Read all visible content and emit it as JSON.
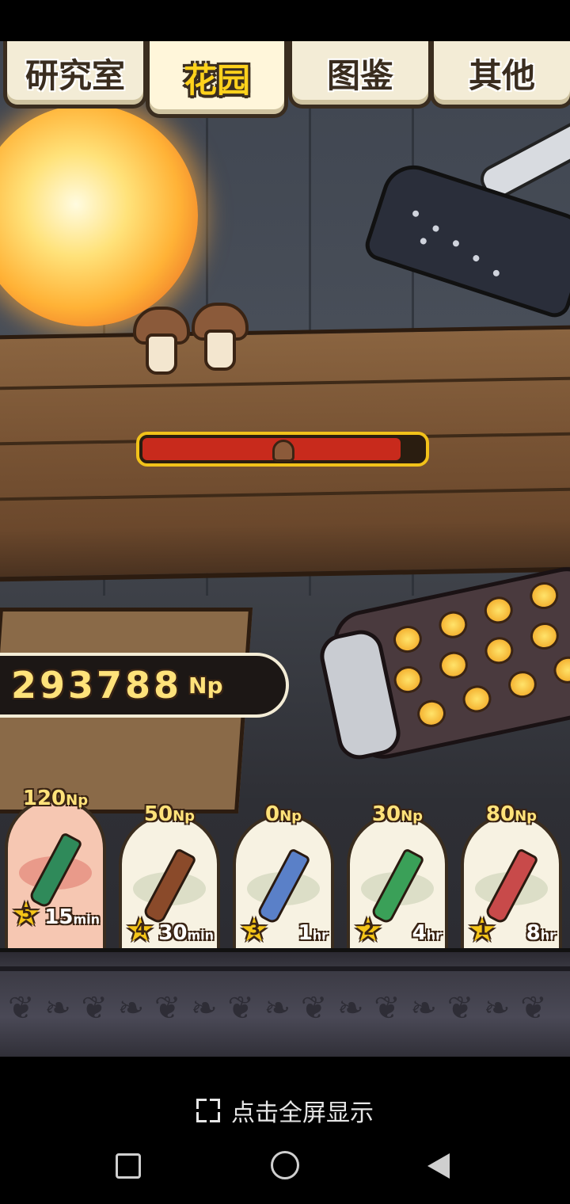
{
  "tabs": [
    {
      "label": "研究室",
      "active": false
    },
    {
      "label": "花园",
      "active": true
    },
    {
      "label": "图鉴",
      "active": false
    },
    {
      "label": "其他",
      "active": false
    }
  ],
  "growth_progress": 0.92,
  "currency": {
    "value": "293788",
    "unit": "Np"
  },
  "items": [
    {
      "price": "120",
      "unit": "Np",
      "stars": "5",
      "time": "15",
      "time_unit": "min",
      "selected": true,
      "icon": "green-bottle-icon"
    },
    {
      "price": "50",
      "unit": "Np",
      "stars": "4",
      "time": "30",
      "time_unit": "min",
      "selected": false,
      "icon": "brown-vial-icon"
    },
    {
      "price": "0",
      "unit": "Np",
      "stars": "3",
      "time": "1",
      "time_unit": "hr",
      "selected": false,
      "icon": "blue-vial-icon"
    },
    {
      "price": "30",
      "unit": "Np",
      "stars": "2",
      "time": "4",
      "time_unit": "hr",
      "selected": false,
      "icon": "green-vial-icon"
    },
    {
      "price": "80",
      "unit": "Np",
      "stars": "1",
      "time": "8",
      "time_unit": "hr",
      "selected": false,
      "icon": "red-vial-icon"
    }
  ],
  "fullscreen_hint": "点击全屏显示",
  "colors": {
    "accent": "#ffd21c",
    "progress": "#c82a1c",
    "currency": "#ffe27a"
  }
}
